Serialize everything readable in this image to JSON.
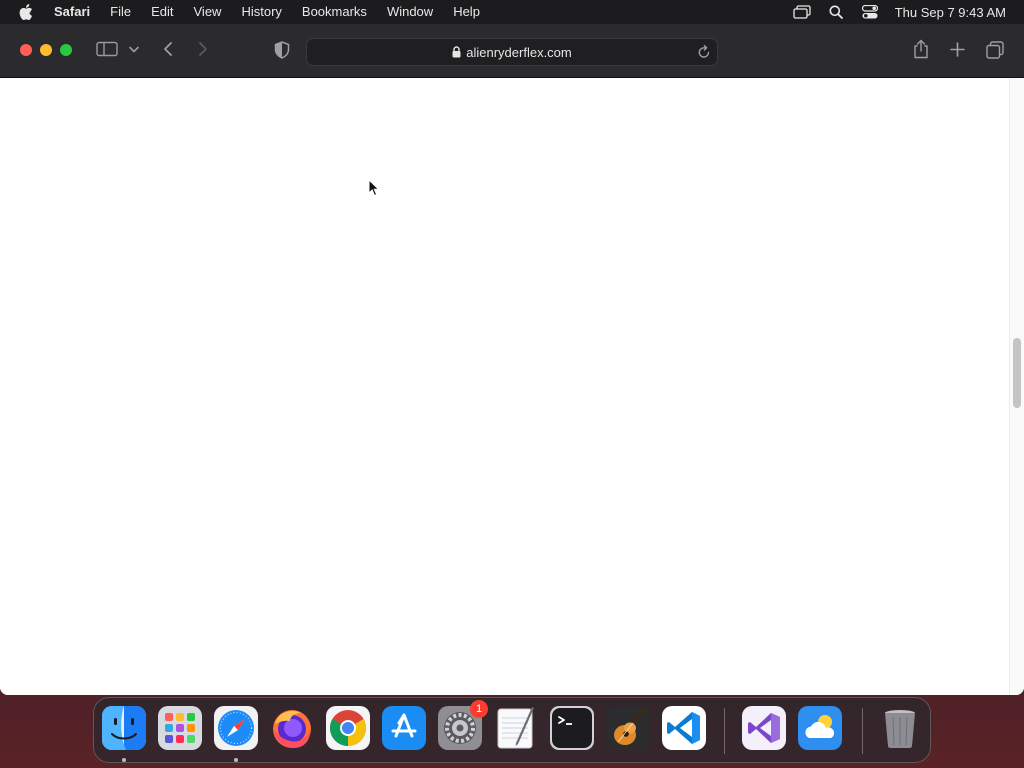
{
  "menubar": {
    "app_name": "Safari",
    "items": [
      "File",
      "Edit",
      "View",
      "History",
      "Bookmarks",
      "Window",
      "Help"
    ],
    "clock": "Thu Sep 7  9:43 AM",
    "status_icons": [
      "screen-mirroring-icon",
      "spotlight-search-icon",
      "control-center-icon"
    ]
  },
  "toolbar": {
    "url": "alienryderflex.com"
  },
  "dock": {
    "apps": [
      {
        "name": "Finder",
        "icon": "finder-icon",
        "running": true
      },
      {
        "name": "Launchpad",
        "icon": "launchpad-icon",
        "running": false
      },
      {
        "name": "Safari",
        "icon": "safari-icon",
        "running": true
      },
      {
        "name": "Firefox",
        "icon": "firefox-icon",
        "running": false
      },
      {
        "name": "Chrome",
        "icon": "chrome-icon",
        "running": false
      },
      {
        "name": "App Store",
        "icon": "app-store-icon",
        "running": false
      },
      {
        "name": "System Settings",
        "icon": "system-settings-icon",
        "running": false,
        "badge": "1"
      },
      {
        "name": "TextEdit",
        "icon": "textedit-icon",
        "running": false
      },
      {
        "name": "Terminal",
        "icon": "terminal-icon",
        "running": false
      },
      {
        "name": "GarageBand",
        "icon": "garageband-icon",
        "running": false
      },
      {
        "name": "VS Code",
        "icon": "vscode-icon",
        "running": false
      },
      {
        "name": "Visual Studio",
        "icon": "visual-studio-icon",
        "running": false
      },
      {
        "name": "Weather",
        "icon": "weather-icon",
        "running": false
      },
      {
        "name": "Trash",
        "icon": "trash-icon",
        "running": false
      }
    ]
  },
  "colors": {
    "close": "#ff5f57",
    "minimize": "#febc2e",
    "zoom": "#28c840",
    "badge": "#ff3b30"
  }
}
